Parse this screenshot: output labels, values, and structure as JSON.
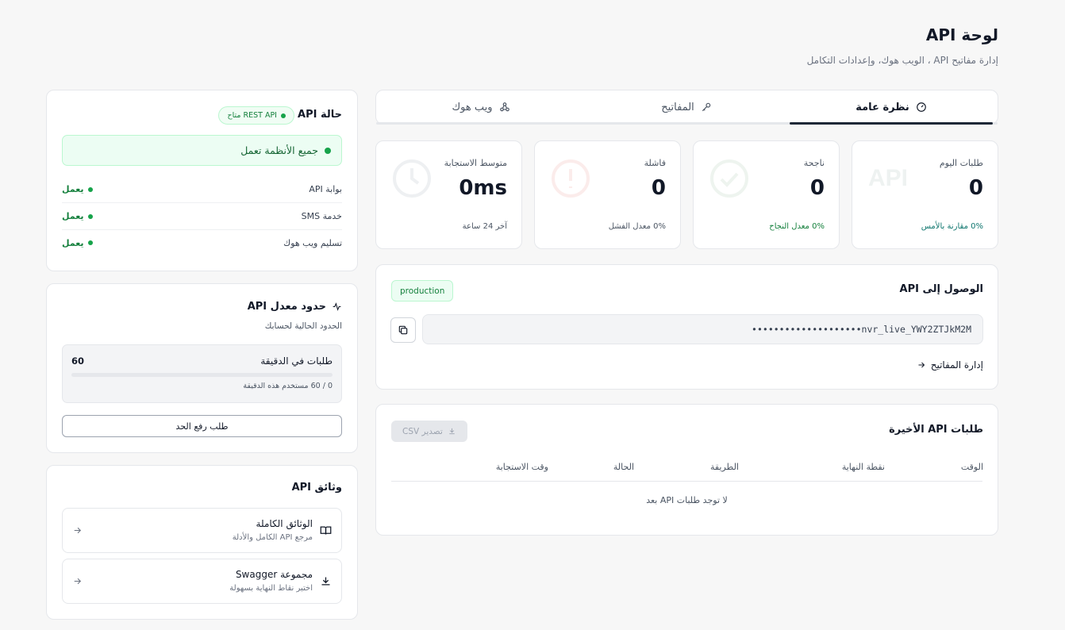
{
  "header": {
    "title": "لوحة API",
    "subtitle": "إدارة مفاتيح API ، الويب هوك، وإعدادات التكامل"
  },
  "tabs": [
    {
      "label": "نظرة عامة",
      "icon": "gauge-icon",
      "active": true
    },
    {
      "label": "المفاتيح",
      "icon": "key-icon",
      "active": false
    },
    {
      "label": "ويب هوك",
      "icon": "webhook-icon",
      "active": false
    }
  ],
  "stats": [
    {
      "label": "طلبات اليوم",
      "value": "0",
      "footer": "0% مقارنة بالأمس",
      "footer_color": "#0f766e",
      "icon": "api-icon"
    },
    {
      "label": "ناجحة",
      "value": "0",
      "footer": "0% معدل النجاح",
      "footer_color": "#15803d",
      "icon": "check-circle-icon"
    },
    {
      "label": "فاشلة",
      "value": "0",
      "footer": "0% معدل الفشل",
      "footer_color": "#4b5563",
      "icon": "alert-circle-icon"
    },
    {
      "label": "متوسط الاستجابة",
      "value": "0ms",
      "footer": "آخر 24 ساعة",
      "footer_color": "#4b5563",
      "icon": "clock-icon"
    }
  ],
  "access": {
    "title": "الوصول إلى API",
    "env_badge": "production",
    "key": "••••••••••••••••••••nvr_live_YWY2ZTJkM2M",
    "manage_link": "إدارة المفاتيح"
  },
  "recent": {
    "title": "طلبات API الأخيرة",
    "export_label": "تصدير CSV",
    "columns": [
      "الوقت",
      "نقطة النهاية",
      "الطريقة",
      "الحالة",
      "وقت الاستجابة"
    ],
    "empty": "لا توجد طلبات API بعد"
  },
  "status": {
    "title": "حالة API",
    "badge": "REST API متاح",
    "banner": "جميع الأنظمة تعمل",
    "services": [
      {
        "name": "بوابة API",
        "state": "يعمل"
      },
      {
        "name": "خدمة SMS",
        "state": "يعمل"
      },
      {
        "name": "تسليم ويب هوك",
        "state": "يعمل"
      }
    ]
  },
  "rate": {
    "title": "حدود معدل API",
    "subtitle": "الحدود الحالية لحسابك",
    "per_minute_label": "طلبات في الدقيقة",
    "per_minute_value": "60",
    "usage_text": "0 / 60 مستخدم هذه الدقيقة",
    "used": 0,
    "limit": 60,
    "button": "طلب رفع الحد"
  },
  "docs": {
    "title": "وثائق API",
    "items": [
      {
        "title": "الوثائق الكاملة",
        "subtitle": "مرجع API الكامل والأدلة",
        "icon": "book-icon"
      },
      {
        "title": "مجموعة Swagger",
        "subtitle": "اختبر نقاط النهاية بسهولة",
        "icon": "download-icon"
      }
    ]
  },
  "colors": {
    "accent": "#15803d",
    "banner_bg": "#ecfdf3",
    "banner_border": "#bbf7d0"
  }
}
